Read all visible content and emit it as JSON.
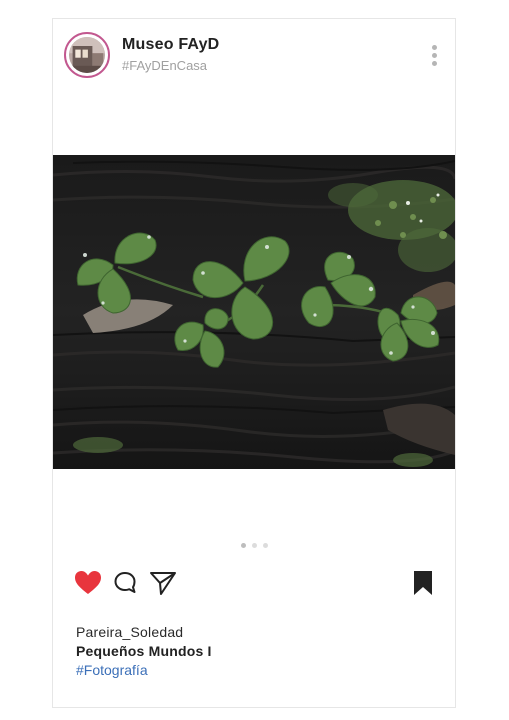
{
  "post": {
    "account_name": "Museo FAyD",
    "account_subtitle": "#FAyDEnCasa",
    "carousel": {
      "total": 3,
      "active": 1
    },
    "liked": true,
    "saved": true,
    "caption": {
      "username": "Pareira_Soledad",
      "title": "Pequeños Mundos I",
      "hashtag": "#Fotografía"
    }
  },
  "icons": {
    "avatar": "avatar-photo",
    "more": "more-vertical-icon",
    "like": "heart-icon",
    "comment": "comment-bubble-icon",
    "share": "paper-plane-icon",
    "save": "bookmark-icon"
  },
  "colors": {
    "like": "#e8353d",
    "hashtag": "#3b6fb8",
    "avatar_ring": "#c2588f",
    "icon": "#222222"
  }
}
